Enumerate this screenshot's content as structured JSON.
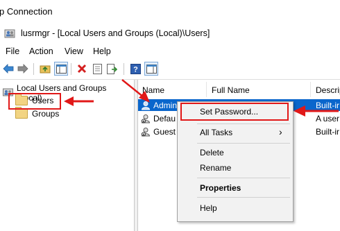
{
  "outer_window": {
    "title": "p Connection"
  },
  "mmc_window": {
    "title": "lusrmgr - [Local Users and Groups (Local)\\Users]"
  },
  "menu": {
    "file": "File",
    "action": "Action",
    "view": "View",
    "help": "Help"
  },
  "toolbar": {
    "icons": [
      "back-arrow-icon",
      "forward-arrow-icon",
      "up-folder-icon",
      "show-hide-tree-icon",
      "delete-icon",
      "properties-icon",
      "export-list-icon",
      "help-icon",
      "show-hide-action-pane-icon"
    ]
  },
  "tree": {
    "root": "Local Users and Groups (Local)",
    "items": [
      {
        "label": "Users"
      },
      {
        "label": "Groups"
      }
    ]
  },
  "list": {
    "columns": {
      "name": "Name",
      "full_name": "Full Name",
      "description": "Descrip"
    },
    "rows": [
      {
        "name": "Admin",
        "full_name": "",
        "description": "Built-ir"
      },
      {
        "name": "Defau",
        "full_name": "",
        "description": "A user"
      },
      {
        "name": "Guest",
        "full_name": "",
        "description": "Built-ir"
      }
    ]
  },
  "context_menu": {
    "items": {
      "set_password": "Set Password...",
      "all_tasks": "All Tasks",
      "all_tasks_arrow": "›",
      "delete": "Delete",
      "rename": "Rename",
      "properties": "Properties",
      "help": "Help"
    }
  },
  "colors": {
    "selection": "#0a66cc",
    "annotation_red": "#e11818"
  }
}
